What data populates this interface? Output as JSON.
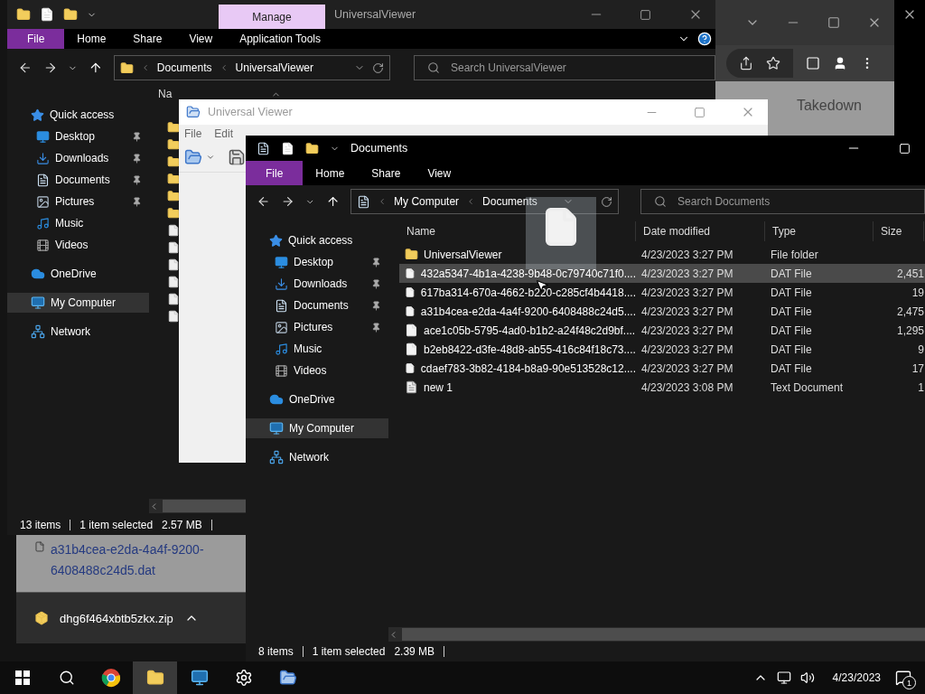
{
  "browser": {
    "page_heading": "Takedown",
    "download_link": "a31b4cea-e2da-4a4f-9200-6408488c24d5.dat",
    "shelf_file": "dhg6f464xbtb5zkx.zip"
  },
  "back_explorer": {
    "context_tab": "Manage",
    "title": "UniversalViewer",
    "ribbon": [
      {
        "label": "File",
        "kind": "file-menu"
      },
      {
        "label": "Home",
        "kind": "tab"
      },
      {
        "label": "Share",
        "kind": "tab"
      },
      {
        "label": "View",
        "kind": "tab"
      },
      {
        "label": "Application Tools",
        "kind": "tab"
      }
    ],
    "path": [
      "Documents",
      "UniversalViewer"
    ],
    "search_placeholder": "Search UniversalViewer",
    "nav": [
      {
        "label": "Quick access",
        "selected": false,
        "children": [
          {
            "label": "Desktop",
            "pinned": true,
            "selected": false
          },
          {
            "label": "Downloads",
            "pinned": true,
            "selected": false
          },
          {
            "label": "Documents",
            "pinned": true,
            "selected": false
          },
          {
            "label": "Pictures",
            "pinned": true,
            "selected": false
          },
          {
            "label": "Music",
            "pinned": false,
            "selected": false
          },
          {
            "label": "Videos",
            "pinned": false,
            "selected": false
          }
        ]
      },
      {
        "label": "OneDrive",
        "selected": false
      },
      {
        "label": "My Computer",
        "selected": true
      },
      {
        "label": "Network",
        "selected": false
      }
    ],
    "column_header": "Na",
    "status": {
      "count": "13 items",
      "selection": "1 item selected",
      "size": "2.57 MB"
    }
  },
  "viewer": {
    "title": "Universal Viewer",
    "menu": [
      "File",
      "Edit"
    ]
  },
  "front_explorer": {
    "title": "Documents",
    "ribbon": [
      {
        "label": "File",
        "kind": "file-menu"
      },
      {
        "label": "Home",
        "kind": "tab"
      },
      {
        "label": "Share",
        "kind": "tab"
      },
      {
        "label": "View",
        "kind": "tab"
      }
    ],
    "path": [
      "My Computer",
      "Documents"
    ],
    "search_placeholder": "Search Documents",
    "nav": [
      {
        "label": "Quick access",
        "selected": false,
        "children": [
          {
            "label": "Desktop",
            "pinned": true,
            "selected": false
          },
          {
            "label": "Downloads",
            "pinned": true,
            "selected": false
          },
          {
            "label": "Documents",
            "pinned": true,
            "selected": false
          },
          {
            "label": "Pictures",
            "pinned": true,
            "selected": false
          },
          {
            "label": "Music",
            "pinned": false,
            "selected": false
          },
          {
            "label": "Videos",
            "pinned": false,
            "selected": false
          }
        ]
      },
      {
        "label": "OneDrive",
        "selected": false
      },
      {
        "label": "My Computer",
        "selected": true
      },
      {
        "label": "Network",
        "selected": false
      }
    ],
    "columns": [
      "Name",
      "Date modified",
      "Type",
      "Size"
    ],
    "files": [
      {
        "kind": "folder",
        "name": "UniversalViewer",
        "date": "4/23/2023 3:27 PM",
        "type": "File folder",
        "selected": false
      },
      {
        "kind": "file",
        "name": "432a5347-4b1a-4238-9b48-0c79740c71f0....",
        "date": "4/23/2023 3:27 PM",
        "type": "DAT File",
        "size": "2,451",
        "selected": true
      },
      {
        "kind": "file",
        "name": "617ba314-670a-4662-b220-c285cf4b4418....",
        "date": "4/23/2023 3:27 PM",
        "type": "DAT File",
        "size": "19",
        "selected": false
      },
      {
        "kind": "file",
        "name": "a31b4cea-e2da-4a4f-9200-6408488c24d5....",
        "date": "4/23/2023 3:27 PM",
        "type": "DAT File",
        "size": "2,475",
        "selected": false
      },
      {
        "kind": "file",
        "name": "ace1c05b-5795-4ad0-b1b2-a24f48c2d9bf....",
        "date": "4/23/2023 3:27 PM",
        "type": "DAT File",
        "size": "1,295",
        "selected": false
      },
      {
        "kind": "file",
        "name": "b2eb8422-d3fe-48d8-ab55-416c84f18c73....",
        "date": "4/23/2023 3:27 PM",
        "type": "DAT File",
        "size": "9",
        "selected": false
      },
      {
        "kind": "file",
        "name": "cdaef783-3b82-4184-b8a9-90e513528c12....",
        "date": "4/23/2023 3:27 PM",
        "type": "DAT File",
        "size": "17",
        "selected": false
      },
      {
        "kind": "text",
        "name": "new 1",
        "date": "4/23/2023 3:08 PM",
        "type": "Text Document",
        "size": "1",
        "selected": false
      }
    ],
    "status": {
      "count": "8 items",
      "selection": "1 item selected",
      "size": "2.39 MB"
    }
  },
  "taskbar": {
    "date": "4/23/2023",
    "notifications": "1"
  }
}
